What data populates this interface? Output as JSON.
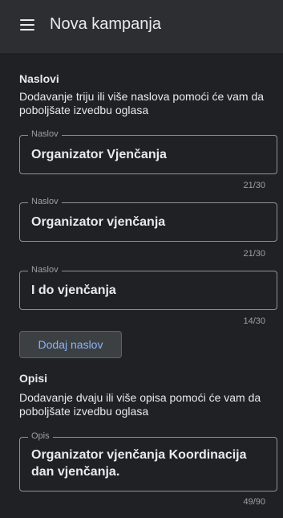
{
  "appbar": {
    "title": "Nova kampanja"
  },
  "headlines": {
    "title": "Naslovi",
    "description": "Dodavanje triju ili više naslova pomoći će vam da poboljšate izvedbu oglasa",
    "fields": [
      {
        "label": "Naslov",
        "value": "Organizator Vjenčanja",
        "counter": "21/30"
      },
      {
        "label": "Naslov",
        "value": "Organizator vjenčanja",
        "counter": "21/30"
      },
      {
        "label": "Naslov",
        "value": "I do vjenčanja",
        "counter": "14/30"
      }
    ],
    "add_button": "Dodaj naslov"
  },
  "descriptions": {
    "title": "Opisi",
    "description": "Dodavanje dvaju ili više opisa pomoći će vam da poboljšate izvedbu oglasa",
    "fields": [
      {
        "label": "Opis",
        "value": "Organizator vjenčanja Koordinacija dan vjenčanja.",
        "counter": "49/90"
      }
    ]
  },
  "colors": {
    "background": "#202124",
    "appbar": "#2d2e31",
    "accent": "#8ab4f8"
  }
}
